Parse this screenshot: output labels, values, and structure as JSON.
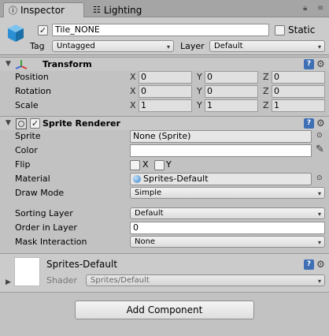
{
  "tabs": [
    {
      "label": "Inspector",
      "icon": "info-icon",
      "active": true
    },
    {
      "label": "Lighting",
      "icon": "lighting-icon",
      "active": false
    }
  ],
  "gameobject": {
    "icon": "cube-icon",
    "active": true,
    "name": "Tile_NONE",
    "static_label": "Static",
    "static_checked": false,
    "tag_label": "Tag",
    "tag_value": "Untagged",
    "layer_label": "Layer",
    "layer_value": "Default"
  },
  "transform": {
    "title": "Transform",
    "rows": [
      {
        "label": "Position",
        "x": "0",
        "y": "0",
        "z": "0"
      },
      {
        "label": "Rotation",
        "x": "0",
        "y": "0",
        "z": "0"
      },
      {
        "label": "Scale",
        "x": "1",
        "y": "1",
        "z": "1"
      }
    ],
    "axis_labels": [
      "X",
      "Y",
      "Z"
    ]
  },
  "sprite_renderer": {
    "title": "Sprite Renderer",
    "enabled": true,
    "sprite_label": "Sprite",
    "sprite_value": "None (Sprite)",
    "color_label": "Color",
    "color_value": "#ffffff",
    "flip_label": "Flip",
    "flip_x_label": "X",
    "flip_y_label": "Y",
    "flip_x": false,
    "flip_y": false,
    "material_label": "Material",
    "material_value": "Sprites-Default",
    "draw_mode_label": "Draw Mode",
    "draw_mode_value": "Simple",
    "sorting_layer_label": "Sorting Layer",
    "sorting_layer_value": "Default",
    "order_in_layer_label": "Order in Layer",
    "order_in_layer_value": "0",
    "mask_interaction_label": "Mask Interaction",
    "mask_interaction_value": "None"
  },
  "material_panel": {
    "name": "Sprites-Default",
    "shader_label": "Shader",
    "shader_value": "Sprites/Default"
  },
  "add_component_label": "Add Component",
  "colors": {
    "panel_bg": "#c2c2c2",
    "header_bg": "#c8c8c8",
    "help_blue": "#3e6fb5"
  }
}
